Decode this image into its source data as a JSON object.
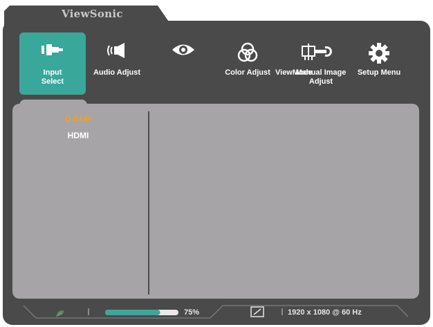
{
  "brand": "ViewSonic",
  "menu": [
    {
      "label": "Input\nSelect",
      "icon": "input-source-icon",
      "active": true
    },
    {
      "label": "Audio Adjust",
      "icon": "speaker-icon",
      "active": false
    },
    {
      "label": "",
      "icon": "eye-icon",
      "active": false
    },
    {
      "label": "Color Adjust",
      "icon": "color-circles-icon",
      "active": false
    },
    {
      "label": "ViewMode",
      "icon": "viewmode-icon",
      "active": false
    },
    {
      "label": "Manual Image\nAdjust",
      "icon": "manual-image-adjust-icon",
      "active": false
    },
    {
      "label": "Setup Menu",
      "icon": "gear-icon",
      "active": false
    }
  ],
  "input_sources": [
    {
      "label": "D-SUB",
      "selected": true
    },
    {
      "label": "HDMI",
      "selected": false
    }
  ],
  "status": {
    "eco_icon": "eco-leaf-icon",
    "brightness_percent": 75,
    "brightness_text": "75%",
    "aspect_icon": "aspect-ratio-icon",
    "resolution": "1920 x 1080 @ 60 Hz"
  },
  "colors": {
    "frame": "#4a4a4a",
    "accent": "#3aa79b",
    "panel": "#a6a4a6",
    "selected_text": "#f0a022",
    "bar_fill": "#3aa79b"
  }
}
